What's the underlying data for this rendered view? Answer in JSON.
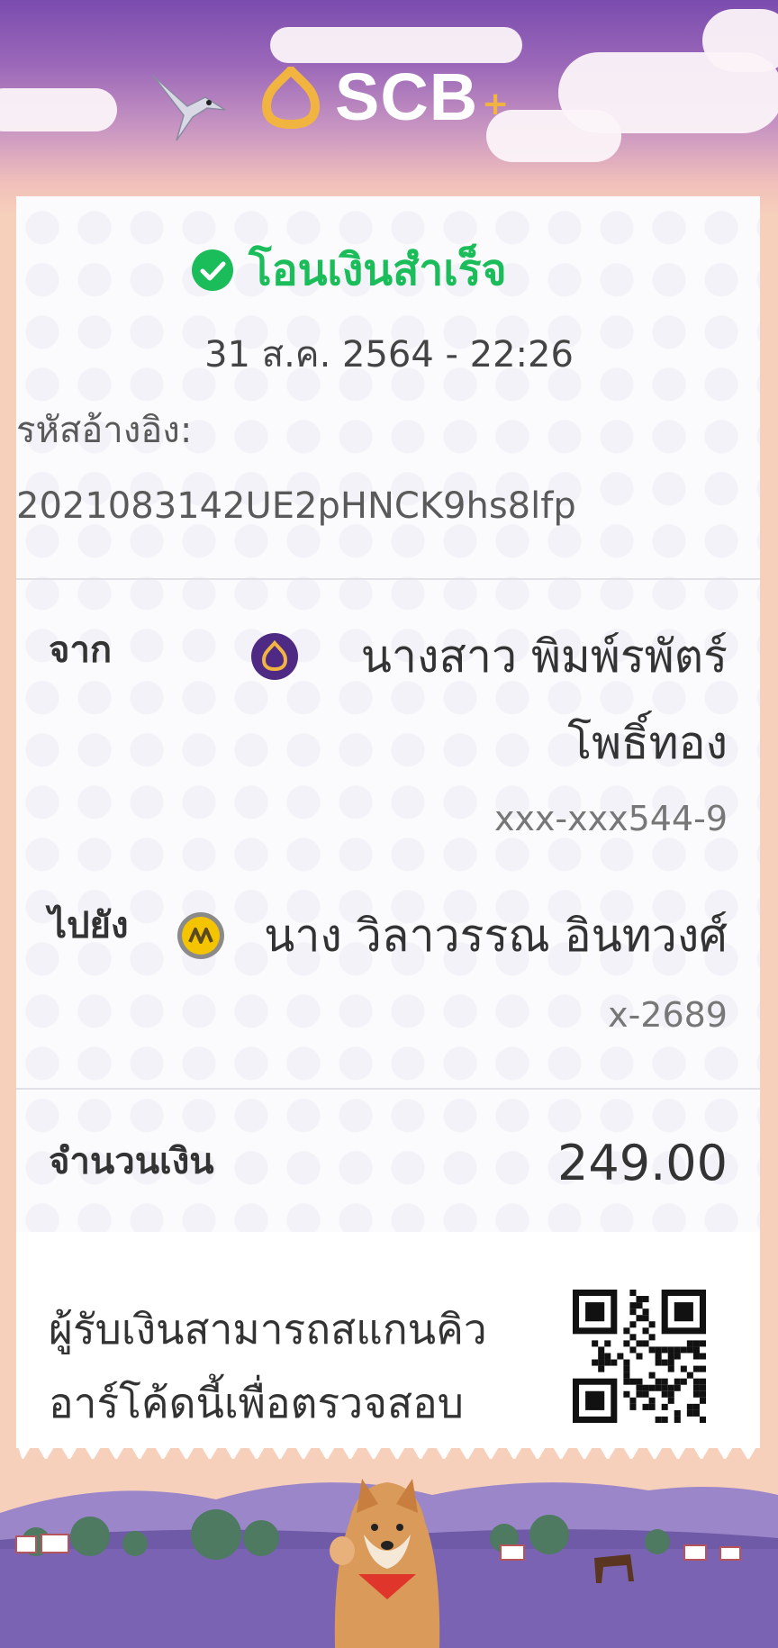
{
  "header": {
    "logo_text": "SCB",
    "logo_plus": "+",
    "bird_icon": "bird-icon",
    "colors": {
      "sky_top": "#7a4cae",
      "sky_bottom": "#f7d0bc",
      "logo_gold": "#f2b441"
    }
  },
  "receipt": {
    "status": "โอนเงินสำเร็จ",
    "status_icon": "check-circle-icon",
    "status_color": "#1bbd5b",
    "date_time": "31 ส.ค. 2564 - 22:26",
    "reference_label": "รหัสอ้างอิง:",
    "reference_value": "2021083142UE2pHNCK9hs8lfp",
    "from": {
      "label": "จาก",
      "bank_icon": "scb-bank-icon",
      "name_line1": "นางสาว พิมพ์รพัตร์",
      "name_line2": "โพธิ์ทอง",
      "account": "xxx-xxx544-9"
    },
    "to": {
      "label": "ไปยัง",
      "bank_icon": "krungsri-bank-icon",
      "name": "นาง วิลาวรรณ อินทวงศ์",
      "account": "x-2689"
    },
    "amount_label": "จำนวนเงิน",
    "amount_value": "249.00",
    "qr_note_line1": "ผู้รับเงินสามารถสแกนคิว",
    "qr_note_line2": "อาร์โค้ดนี้เพื่อตรวจสอบ",
    "qr_icon": "qr-code-icon"
  },
  "footer": {
    "illustration": "lavender-field-with-shiba-dog-illustration"
  }
}
